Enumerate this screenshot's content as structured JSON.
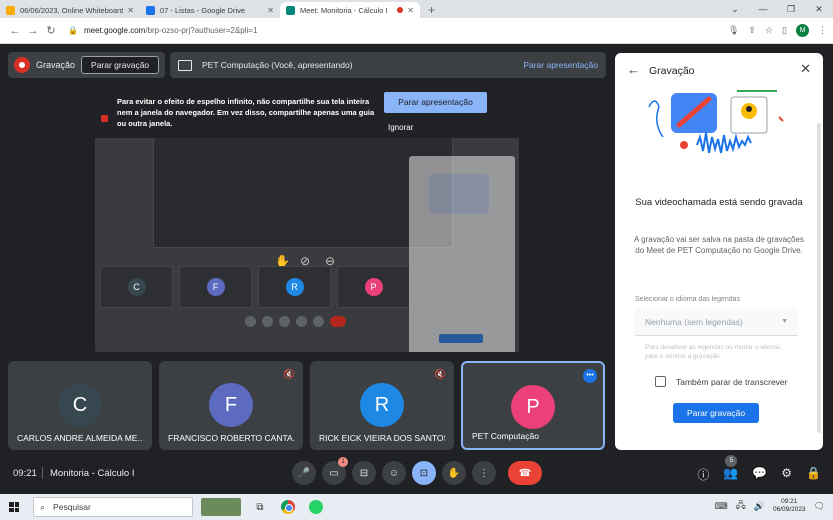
{
  "browser": {
    "tabs": [
      {
        "title": "06/06/2023, Online Whiteboard",
        "favicon_color": "#f9ab00",
        "active": false
      },
      {
        "title": "07 - Listas - Google Drive",
        "favicon_color": "#1a73e8",
        "active": false
      },
      {
        "title": "Meet: Monitoria - Cálculo I",
        "favicon_color": "#00897b",
        "active": true
      }
    ],
    "new_tab": "+",
    "url_host": "meet.google.com",
    "url_path": "/brp-ozso-prj?authuser=2&pli=1",
    "profile_initial": "M"
  },
  "meet": {
    "recording_label": "Gravação",
    "stop_recording_top": "Parar gravação",
    "presenting_text": "PET Computação (Você, apresentando)",
    "stop_presenting": "Parar apresentação",
    "warning": {
      "text": "Para evitar o efeito de espelho infinito, não compartilhe sua tela inteira nem a janela do navegador. Em vez disso, compartilhe apenas uma guia ou outra janela.",
      "share_tab": "Parar apresentação",
      "ignore": "Ignorar"
    },
    "participants": [
      {
        "initial": "C",
        "name": "CARLOS ANDRE ALMEIDA ME...",
        "color": "#37474f",
        "muted": false
      },
      {
        "initial": "F",
        "name": "FRANCISCO ROBERTO CANTA...",
        "color": "#5c6bc0",
        "muted": true
      },
      {
        "initial": "R",
        "name": "RICK EICK VIEIRA DOS SANTOS",
        "color": "#1e88e5",
        "muted": true
      },
      {
        "initial": "P",
        "name": "PET Computação",
        "color": "#ec407a",
        "muted": false,
        "active": true
      }
    ],
    "time": "09:21",
    "meeting_name": "Monitoria - Cálculo I",
    "people_count": "5",
    "raise_badge": "1"
  },
  "panel": {
    "title": "Gravação",
    "heading": "Sua videochamada está sendo gravada",
    "description": "A gravação vai ser salva na pasta de gravações do Meet de PET Computação no Google Drive.",
    "language_label": "Selecionar o idioma das legendas",
    "language_value": "Nenhuma (sem legendas)",
    "hint": "Para desativar as legendas ou mudar o idioma, pare e reinicie a gravação.",
    "transcribe_label": "Também parar de transcrever",
    "stop_button": "Parar gravação"
  },
  "taskbar": {
    "search_placeholder": "Pesquisar",
    "time": "09:21",
    "date": "06/09/2023"
  }
}
